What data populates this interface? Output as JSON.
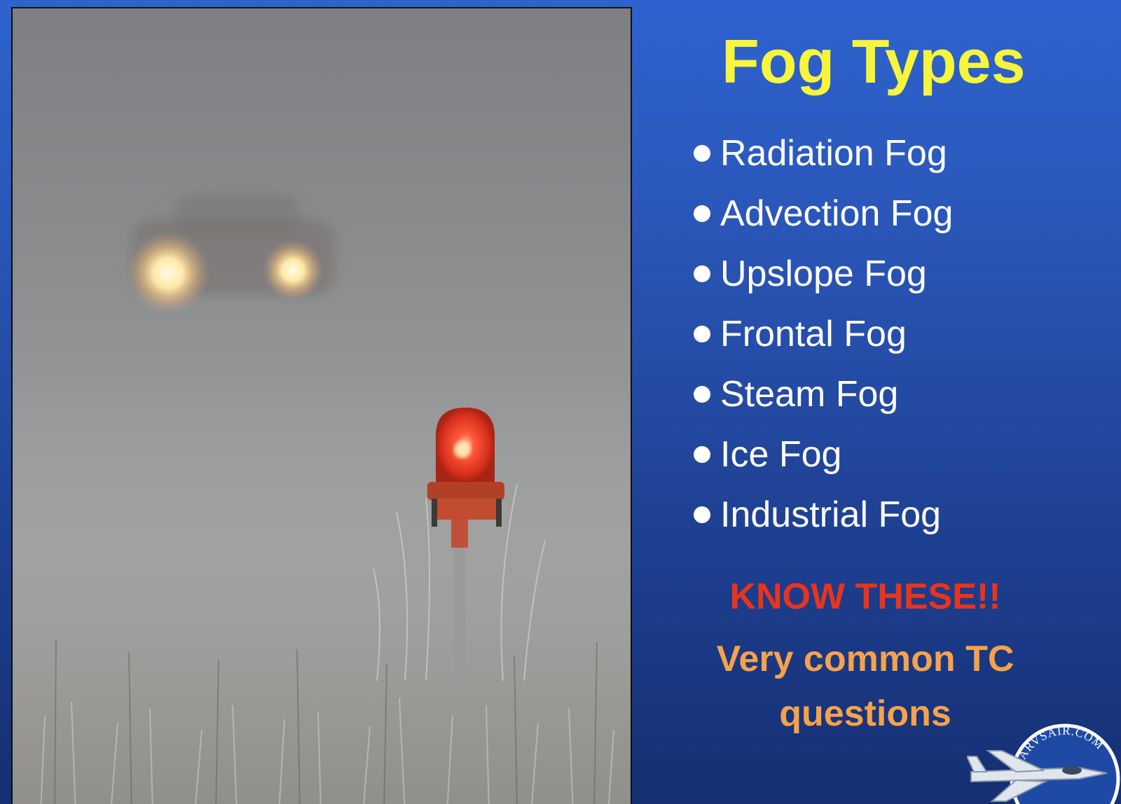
{
  "slide": {
    "title": "Fog Types",
    "fog_types": [
      "Radiation Fog",
      "Advection Fog",
      "Upslope Fog",
      "Frontal Fog",
      "Steam Fog",
      "Ice Fog",
      "Industrial Fog"
    ],
    "emphasis": "KNOW THESE!!",
    "note": "Very common TC questions",
    "logo_text": "HARVSAIR.COM"
  },
  "colors": {
    "title": "#f6f53c",
    "emphasis": "#e8341d",
    "note": "#f6a24a",
    "background_top": "#2e63cf",
    "background_bottom": "#152f72"
  }
}
